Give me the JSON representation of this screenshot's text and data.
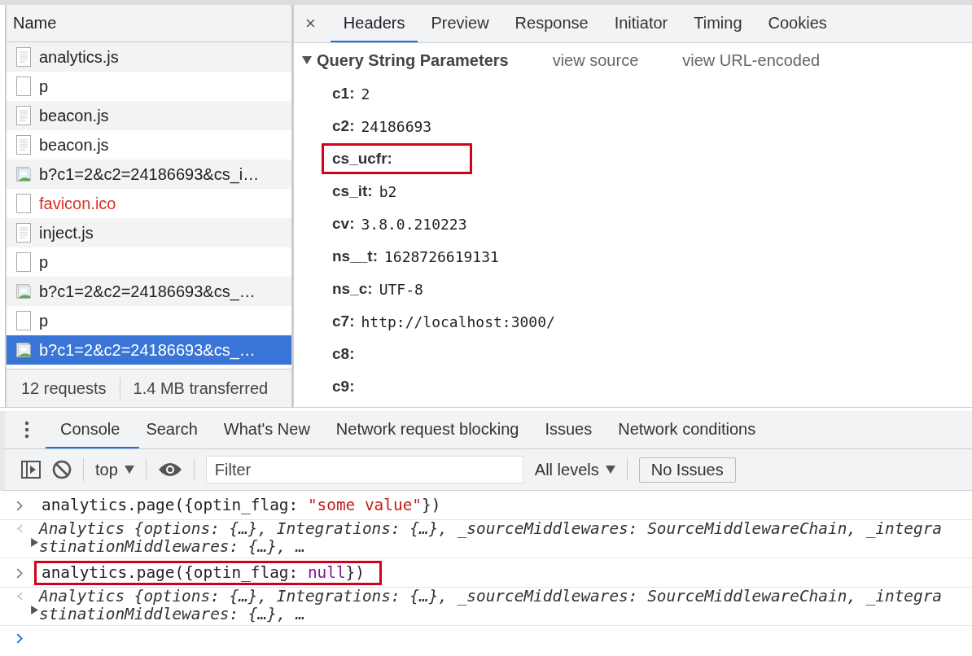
{
  "network": {
    "column": "Name",
    "requests": [
      {
        "name": "analytics.js",
        "kind": "script",
        "error": false,
        "selected": false
      },
      {
        "name": "p",
        "kind": "blank",
        "error": false,
        "selected": false
      },
      {
        "name": "beacon.js",
        "kind": "script",
        "error": false,
        "selected": false
      },
      {
        "name": "beacon.js",
        "kind": "script",
        "error": false,
        "selected": false
      },
      {
        "name": "b?c1=2&c2=24186693&cs_i…",
        "kind": "image",
        "error": false,
        "selected": false
      },
      {
        "name": "favicon.ico",
        "kind": "blank",
        "error": true,
        "selected": false
      },
      {
        "name": "inject.js",
        "kind": "script",
        "error": false,
        "selected": false
      },
      {
        "name": "p",
        "kind": "blank",
        "error": false,
        "selected": false
      },
      {
        "name": "b?c1=2&c2=24186693&cs_…",
        "kind": "image",
        "error": false,
        "selected": false
      },
      {
        "name": "p",
        "kind": "blank",
        "error": false,
        "selected": false
      },
      {
        "name": "b?c1=2&c2=24186693&cs_…",
        "kind": "image",
        "error": false,
        "selected": true
      }
    ],
    "status": [
      "12 requests",
      "1.4 MB transferred"
    ]
  },
  "details": {
    "close": "×",
    "tabs": [
      {
        "label": "Headers",
        "selected": true
      },
      {
        "label": "Preview",
        "selected": false
      },
      {
        "label": "Response",
        "selected": false
      },
      {
        "label": "Initiator",
        "selected": false
      },
      {
        "label": "Timing",
        "selected": false
      },
      {
        "label": "Cookies",
        "selected": false
      }
    ],
    "section": {
      "title": "Query String Parameters",
      "expanded": true,
      "links": [
        "view source",
        "view URL-encoded"
      ]
    },
    "params": [
      {
        "key": "c1:",
        "value": "2",
        "highlighted": false
      },
      {
        "key": "c2:",
        "value": "24186693",
        "highlighted": false
      },
      {
        "key": "cs_ucfr:",
        "highlighted": true
      },
      {
        "key": "cs_it:",
        "value": "b2",
        "highlighted": false
      },
      {
        "key": "cv:",
        "value": "3.8.0.210223",
        "highlighted": false
      },
      {
        "key": "ns__t:",
        "value": "1628726619131",
        "highlighted": false
      },
      {
        "key": "ns_c:",
        "value": "UTF-8",
        "highlighted": false
      },
      {
        "key": "c7:",
        "value": "http://localhost:3000/",
        "highlighted": false
      },
      {
        "key": "c8:",
        "highlighted": false
      },
      {
        "key": "c9:",
        "highlighted": false
      }
    ]
  },
  "drawer": {
    "tabs": [
      {
        "label": "Console",
        "selected": true
      },
      {
        "label": "Search",
        "selected": false
      },
      {
        "label": "What's New",
        "selected": false
      },
      {
        "label": "Network request blocking",
        "selected": false
      },
      {
        "label": "Issues",
        "selected": false
      },
      {
        "label": "Network conditions",
        "selected": false
      }
    ],
    "toolbar": {
      "context": "top",
      "filter_placeholder": "Filter",
      "levels": "All levels",
      "issues": "No Issues"
    },
    "entries": [
      {
        "kind": "input",
        "highlighted": false,
        "parts": [
          {
            "text": "analytics.page({optin_flag: ",
            "kind": "plain"
          },
          {
            "text": "\"some value\"",
            "kind": "string"
          },
          {
            "text": "})",
            "kind": "plain"
          }
        ]
      },
      {
        "kind": "output",
        "lines": [
          "Analytics {options: {…}, Integrations: {…}, _sourceMiddlewares: SourceMiddlewareChain, _integra",
          "stinationMiddlewares: {…}, …"
        ]
      },
      {
        "kind": "input",
        "highlighted": true,
        "parts": [
          {
            "text": "analytics.page({optin_flag: ",
            "kind": "plain"
          },
          {
            "text": "null",
            "kind": "null"
          },
          {
            "text": "})",
            "kind": "plain"
          }
        ]
      },
      {
        "kind": "output",
        "lines": [
          "Analytics {options: {…}, Integrations: {…}, _sourceMiddlewares: SourceMiddlewareChain, _integra",
          "stinationMiddlewares: {…}, …"
        ]
      }
    ]
  }
}
